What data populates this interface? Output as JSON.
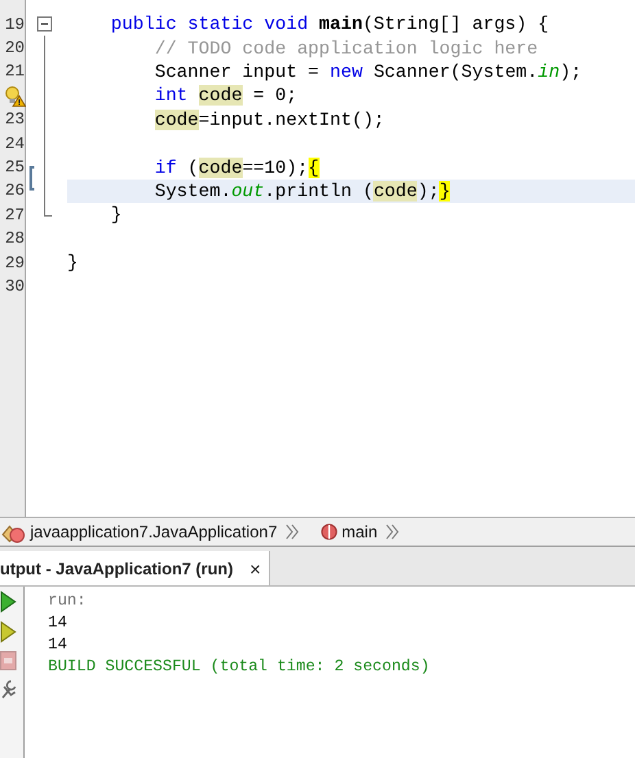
{
  "editor": {
    "lines": [
      {
        "number": "19",
        "fold_start": true,
        "in_fold": false,
        "fold_end": false,
        "current": false,
        "tokens": [
          {
            "kind": "keyword",
            "text": "    public static void "
          },
          {
            "kind": "method",
            "text": "main"
          },
          {
            "kind": "plain",
            "text": "(String[] args) {"
          }
        ]
      },
      {
        "number": "20",
        "fold_start": false,
        "in_fold": true,
        "fold_end": false,
        "current": false,
        "tokens": [
          {
            "kind": "comment",
            "text": "        // TODO code application logic here"
          }
        ]
      },
      {
        "number": "21",
        "fold_start": false,
        "in_fold": true,
        "fold_end": false,
        "current": false,
        "tokens": [
          {
            "kind": "plain",
            "text": "        Scanner input = "
          },
          {
            "kind": "keyword",
            "text": "new"
          },
          {
            "kind": "plain",
            "text": " Scanner(System."
          },
          {
            "kind": "field",
            "text": "in"
          },
          {
            "kind": "plain",
            "text": ");"
          }
        ]
      },
      {
        "warning": true,
        "fold_start": false,
        "in_fold": true,
        "fold_end": false,
        "current": false,
        "tokens": [
          {
            "kind": "keyword",
            "text": "        int "
          },
          {
            "kind": "occurrence",
            "text": "code"
          },
          {
            "kind": "plain",
            "text": " = 0;"
          }
        ]
      },
      {
        "number": "23",
        "fold_start": false,
        "in_fold": true,
        "fold_end": false,
        "current": false,
        "tokens": [
          {
            "kind": "occurrence",
            "text": "        code"
          },
          {
            "kind": "plain",
            "text": "=input.nextInt();"
          }
        ]
      },
      {
        "number": "24",
        "fold_start": false,
        "in_fold": true,
        "fold_end": false,
        "current": false
      },
      {
        "number": "25",
        "fold_start": false,
        "in_fold": true,
        "fold_end": false,
        "bracket": true,
        "current": false,
        "tokens": [
          {
            "kind": "keyword",
            "text": "        if"
          },
          {
            "kind": "plain",
            "text": " ("
          },
          {
            "kind": "occurrence",
            "text": "code"
          },
          {
            "kind": "plain",
            "text": "==10);"
          },
          {
            "kind": "brace",
            "text": "{"
          }
        ]
      },
      {
        "number": "26",
        "fold_start": false,
        "in_fold": true,
        "fold_end": false,
        "current": true,
        "tokens": [
          {
            "kind": "plain",
            "text": "        System."
          },
          {
            "kind": "field",
            "text": "out"
          },
          {
            "kind": "plain",
            "text": ".println ("
          },
          {
            "kind": "occurrence",
            "text": "code"
          },
          {
            "kind": "plain",
            "text": ");"
          },
          {
            "kind": "brace",
            "text": "}"
          }
        ]
      },
      {
        "number": "27",
        "fold_start": false,
        "in_fold": false,
        "fold_end": true,
        "current": false,
        "tokens": [
          {
            "kind": "plain",
            "text": "    }"
          }
        ]
      },
      {
        "number": "28",
        "fold_start": false,
        "in_fold": false,
        "fold_end": false,
        "current": false
      },
      {
        "number": "29",
        "fold_start": false,
        "in_fold": false,
        "fold_end": false,
        "current": false,
        "tokens": [
          {
            "kind": "plain",
            "text": "}"
          }
        ]
      },
      {
        "number": "30",
        "fold_start": false,
        "in_fold": false,
        "fold_end": false,
        "current": false
      }
    ]
  },
  "breadcrumb": [
    {
      "kind": "class",
      "label": "javaapplication7.JavaApplication7"
    },
    {
      "kind": "method",
      "label": "main"
    }
  ],
  "output": {
    "tab": {
      "label": "utput - JavaApplication7 (run)",
      "close": "×",
      "selected": true
    },
    "tools": [
      {
        "kind": "run",
        "disabled": false
      },
      {
        "kind": "rerun",
        "disabled": false
      },
      {
        "kind": "stop",
        "disabled": true
      },
      {
        "kind": "settings",
        "disabled": false
      }
    ],
    "lines": [
      {
        "kind": "info",
        "text": "run:"
      },
      {
        "kind": "plain",
        "text": "14"
      },
      {
        "kind": "plain",
        "text": "14"
      },
      {
        "kind": "success",
        "text": "BUILD SUCCESSFUL (total time: 2 seconds)"
      }
    ]
  }
}
